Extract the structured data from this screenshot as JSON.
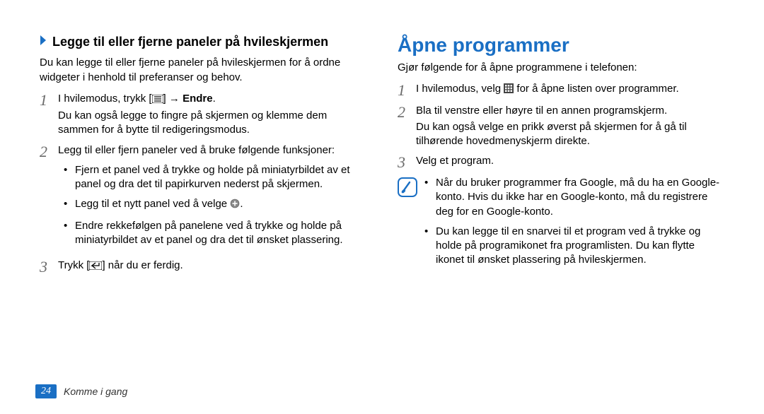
{
  "left": {
    "subheading": "Legge til eller fjerne paneler på hvileskjermen",
    "intro": "Du kan legge til eller fjerne paneler på hvileskjermen for å ordne widgeter i henhold til preferanser og behov.",
    "step1_a": "I hvilemodus, trykk [",
    "step1_b": "] → ",
    "step1_bold": "Endre",
    "step1_c": ".",
    "step1_extra": "Du kan også legge to fingre på skjermen og klemme dem sammen for å bytte til redigeringsmodus.",
    "step2": "Legg til eller fjern paneler ved å bruke følgende funksjoner:",
    "step2_b1": "Fjern et panel ved å trykke og holde på miniatyrbildet av et panel og dra det til papirkurven nederst på skjermen.",
    "step2_b2_a": "Legg til et nytt panel ved å velge ",
    "step2_b2_b": ".",
    "step2_b3": "Endre rekkefølgen på panelene ved å trykke og holde på miniatyrbildet av et panel og dra det til ønsket plassering.",
    "step3_a": "Trykk [",
    "step3_b": "] når du er ferdig."
  },
  "right": {
    "heading": "Åpne programmer",
    "intro": "Gjør følgende for å åpne programmene i telefonen:",
    "step1_a": "I hvilemodus, velg ",
    "step1_b": " for å åpne listen over programmer.",
    "step2": "Bla til venstre eller høyre til en annen programskjerm.",
    "step2_extra": "Du kan også velge en prikk øverst på skjermen for å gå til tilhørende hovedmenyskjerm direkte.",
    "step3": "Velg et program.",
    "note_b1": "Når du bruker programmer fra Google, må du ha en Google-konto. Hvis du ikke har en Google-konto, må du registrere deg for en Google-konto.",
    "note_b2": "Du kan legge til en snarvei til et program ved å trykke og holde på programikonet fra programlisten. Du kan flytte ikonet til ønsket plassering på hvileskjermen."
  },
  "footer": {
    "page": "24",
    "section": "Komme i gang"
  }
}
